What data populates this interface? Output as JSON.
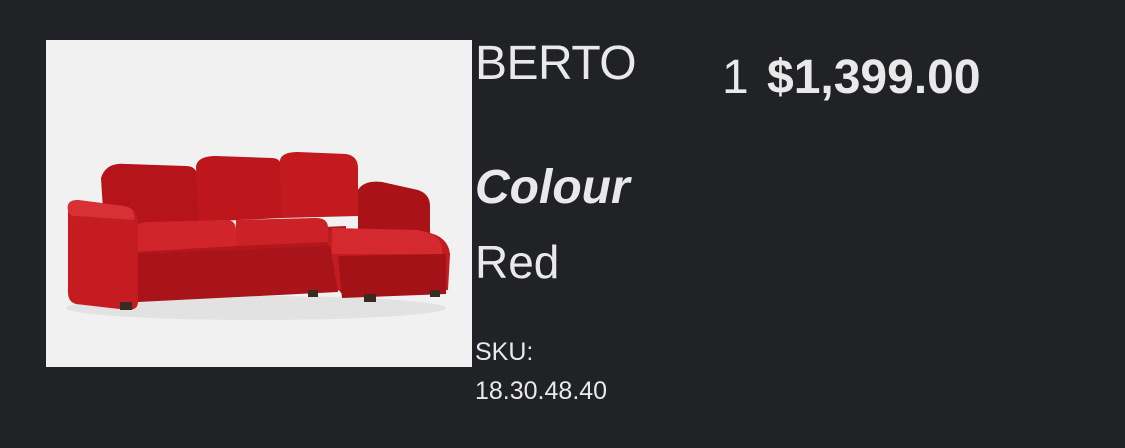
{
  "item": {
    "name": "BERTO",
    "image_alt": "Red sectional sofa",
    "quantity": "1",
    "price": "$1,399.00",
    "attribute_label": "Colour",
    "attribute_value": "Red",
    "sku_label": "SKU:",
    "sku_value": "18.30.48.40"
  },
  "colors": {
    "background": "#212226",
    "text": "#e9e9e9",
    "image_background": "#f1f1f2",
    "sofa": "#c21a1f"
  }
}
